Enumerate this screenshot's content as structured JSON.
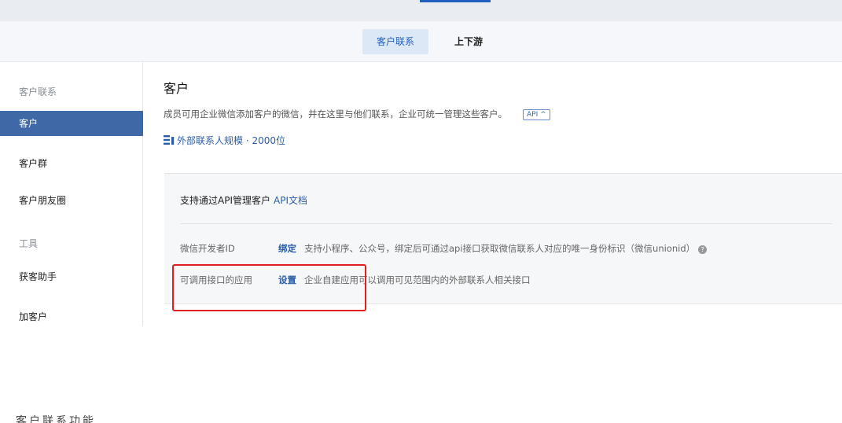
{
  "tabs": [
    {
      "label": "客户联系"
    },
    {
      "label": "上下游"
    }
  ],
  "sidebar": {
    "items": [
      {
        "label": "客户联系"
      },
      {
        "label": "客户"
      },
      {
        "label": "客户群"
      },
      {
        "label": "客户朋友圈"
      },
      {
        "label": "工具"
      },
      {
        "label": "获客助手"
      },
      {
        "label": "加客户"
      }
    ]
  },
  "main": {
    "title": "客户",
    "description": "成员可用企业微信添加客户的微信，并在这里与他们联系，企业可统一管理这些客户。",
    "api_tag": "API ^",
    "scale": "外部联系人规模 · 2000位"
  },
  "panel": {
    "head": "支持通过API管理客户",
    "head_link": "API文档",
    "rows": [
      {
        "label": "微信开发者ID",
        "action": "绑定",
        "note": "支持小程序、公众号，绑定后可通过api接口获取微信联系人对应的唯一身份标识（微信unionid）"
      },
      {
        "label": "可调用接口的应用",
        "action": "设置",
        "note": "企业自建应用可以调用可见范围内的外部联系人相关接口"
      }
    ]
  },
  "bottom_text": "客户联系功能",
  "colors": {
    "accent": "#3f68a6",
    "link": "#2b5ea6",
    "highlight": "#e02020"
  }
}
